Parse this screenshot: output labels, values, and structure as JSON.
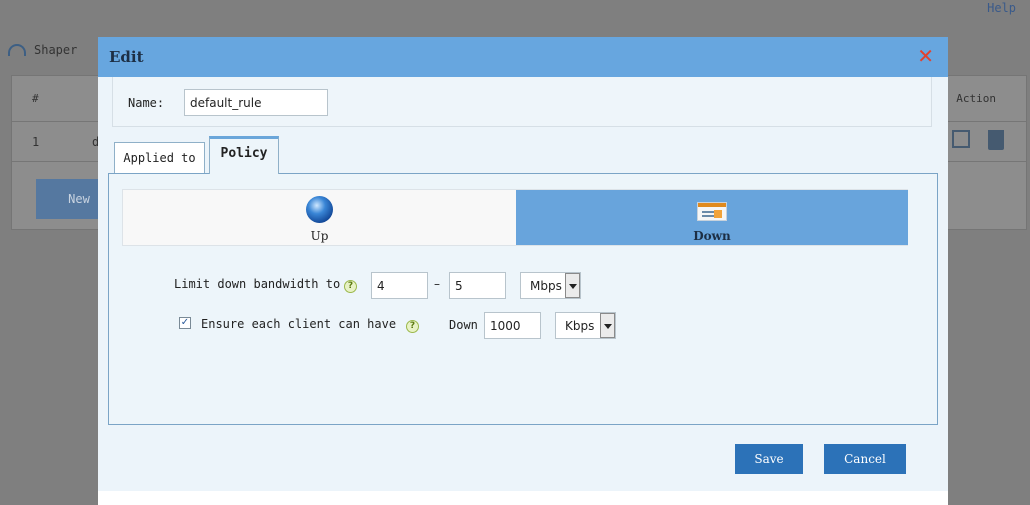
{
  "background": {
    "help_link": "Help",
    "shaper_label": "Shaper",
    "table_hash_header": "#",
    "table_action_header": "Action",
    "row_number": "1",
    "row_name_partial": "d",
    "new_button": "New"
  },
  "dialog": {
    "title": "Edit",
    "close_glyph": "✕",
    "name_label": "Name:",
    "name_value": "default_rule",
    "tabs": [
      {
        "label": "Applied to",
        "active": false
      },
      {
        "label": "Policy",
        "active": true
      }
    ],
    "direction": {
      "up_label": "Up",
      "down_label": "Down",
      "selected": "Down"
    },
    "limit": {
      "label": "Limit down bandwidth to",
      "min_value": "4",
      "separator": "–",
      "max_value": "5",
      "unit": "Mbps"
    },
    "ensure": {
      "checked": true,
      "check_glyph": "✓",
      "label": "Ensure each client can have",
      "down_label": "Down",
      "value": "1000",
      "unit": "Kbps"
    },
    "help_glyph": "?",
    "save_label": "Save",
    "cancel_label": "Cancel"
  },
  "colors": {
    "header_blue": "#67a6df",
    "button_blue": "#2c72b8",
    "close_red": "#e4412d",
    "overlay_gray": "#7f7f7f"
  },
  "icons": [
    "gauge-icon",
    "close-icon",
    "globe-icon",
    "download-card-icon",
    "help-icon",
    "dropdown-arrow-icon",
    "edit-icon",
    "trash-icon"
  ]
}
